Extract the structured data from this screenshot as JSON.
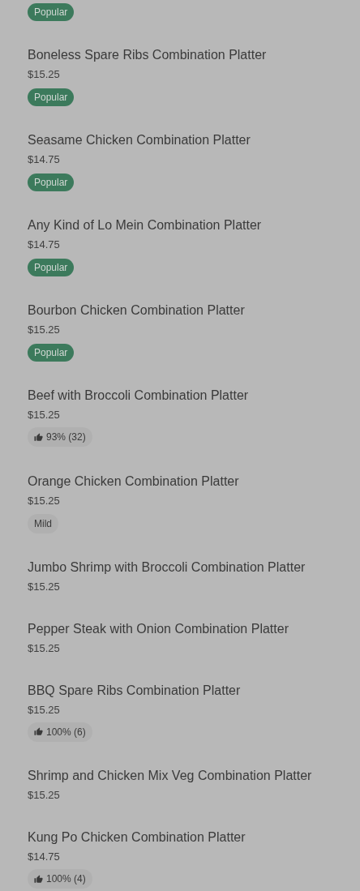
{
  "items": [
    {
      "badge": {
        "kind": "popular",
        "text": "Popular"
      }
    },
    {
      "name": "Boneless Spare Ribs Combination Platter",
      "price": "$15.25",
      "badge": {
        "kind": "popular",
        "text": "Popular"
      }
    },
    {
      "name": "Seasame Chicken Combination Platter",
      "price": "$14.75",
      "badge": {
        "kind": "popular",
        "text": "Popular"
      }
    },
    {
      "name": "Any Kind of Lo Mein Combination Platter",
      "price": "$14.75",
      "badge": {
        "kind": "popular",
        "text": "Popular"
      }
    },
    {
      "name": "Bourbon Chicken Combination Platter",
      "price": "$15.25",
      "badge": {
        "kind": "popular",
        "text": "Popular"
      }
    },
    {
      "name": "Beef with Broccoli Combination Platter",
      "price": "$15.25",
      "badge": {
        "kind": "rating",
        "text": "93% (32)"
      }
    },
    {
      "name": "Orange Chicken Combination Platter",
      "price": "$15.25",
      "badge": {
        "kind": "tag",
        "text": "Mild"
      }
    },
    {
      "name": "Jumbo Shrimp with Broccoli Combination Platter",
      "price": "$15.25"
    },
    {
      "name": "Pepper Steak with Onion Combination Platter",
      "price": "$15.25"
    },
    {
      "name": "BBQ Spare Ribs Combination Platter",
      "price": "$15.25",
      "badge": {
        "kind": "rating",
        "text": "100% (6)"
      }
    },
    {
      "name": "Shrimp and Chicken Mix Veg Combination Platter",
      "price": "$15.25"
    },
    {
      "name": "Kung Po Chicken Combination Platter",
      "price": "$14.75",
      "badge": {
        "kind": "rating",
        "text": "100% (4)"
      }
    }
  ]
}
